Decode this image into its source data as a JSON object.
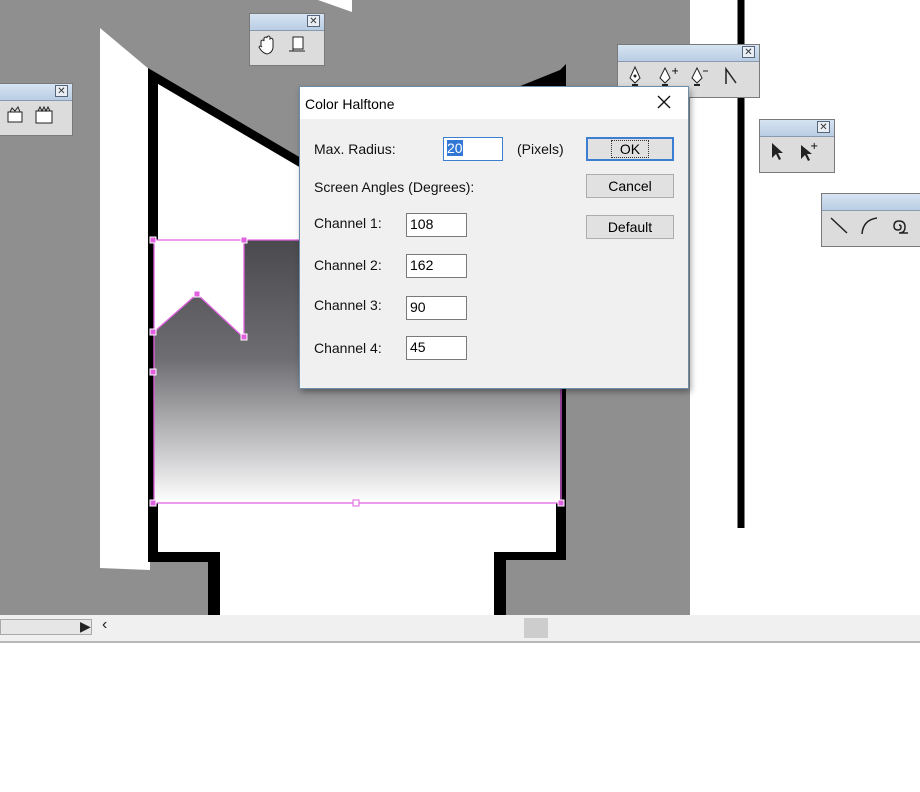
{
  "dialog": {
    "title": "Color Halftone",
    "max_radius_label": "Max. Radius:",
    "max_radius_value": "20",
    "max_radius_unit": "(Pixels)",
    "screen_angles_label": "Screen Angles (Degrees):",
    "channels": [
      {
        "label": "Channel 1:",
        "value": "108"
      },
      {
        "label": "Channel 2:",
        "value": "162"
      },
      {
        "label": "Channel 3:",
        "value": "90"
      },
      {
        "label": "Channel 4:",
        "value": "45"
      }
    ],
    "ok_label": "OK",
    "cancel_label": "Cancel",
    "default_label": "Default",
    "close_icon": "close-icon"
  },
  "palettes": {
    "hand_palette": [
      "hand-icon",
      "page-tool-icon"
    ],
    "pen_palette": [
      "pen-icon",
      "add-anchor-icon",
      "delete-anchor-icon",
      "convert-anchor-icon"
    ],
    "select_palette": [
      "selection-arrow-icon",
      "direct-select-icon"
    ],
    "line_palette": [
      "line-segment-icon",
      "arc-icon",
      "spiral-icon"
    ],
    "left_palette": [
      "crop-icon",
      "slice-icon"
    ]
  },
  "colors": {
    "selection": "#e060e0",
    "dialog_accent": "#3c7fd1"
  }
}
